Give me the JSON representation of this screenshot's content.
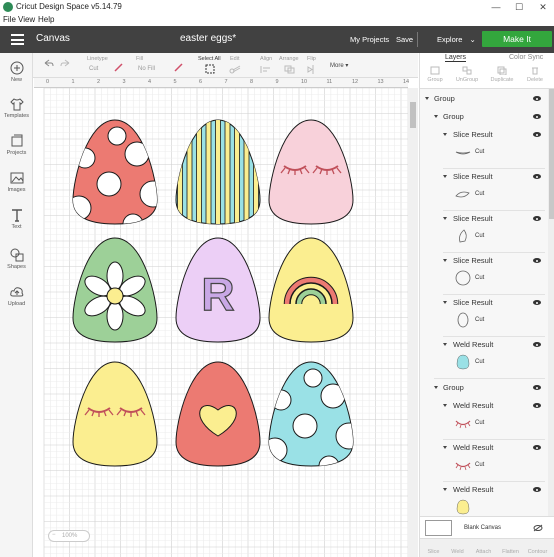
{
  "window": {
    "title": "Cricut Design Space  v5.14.79",
    "controls": [
      "—",
      "☐",
      "✕"
    ]
  },
  "menu": [
    "File",
    "View",
    "Help"
  ],
  "header": {
    "canvas_label": "Canvas",
    "doc_title": "easter eggs*",
    "my_projects": "My Projects",
    "save": "Save",
    "explore": "Explore",
    "make_it": "Make It"
  },
  "toolbar": {
    "linetype_label": "Linetype",
    "linetype_value": "Cut",
    "fill_label": "Fill",
    "fill_value": "No Fill",
    "select_all": "Select All",
    "edit": "Edit",
    "align": "Align",
    "arrange": "Arrange",
    "flip": "Flip",
    "more": "More"
  },
  "sidebar": [
    {
      "label": "New",
      "icon": "plus-icon"
    },
    {
      "label": "Templates",
      "icon": "shirt-icon"
    },
    {
      "label": "Projects",
      "icon": "projects-icon"
    },
    {
      "label": "Images",
      "icon": "image-icon"
    },
    {
      "label": "Text",
      "icon": "text-icon"
    },
    {
      "label": "Shapes",
      "icon": "shapes-icon"
    },
    {
      "label": "Upload",
      "icon": "upload-icon"
    }
  ],
  "ruler": {
    "top": [
      "0",
      "1",
      "2",
      "3",
      "4",
      "5",
      "6",
      "7",
      "8",
      "9",
      "10",
      "11",
      "12",
      "13",
      "14"
    ],
    "left": [
      "0",
      "1",
      "2",
      "3",
      "4",
      "5",
      "6",
      "7",
      "8",
      "9",
      "10",
      "11",
      "12"
    ]
  },
  "zoom": "100%",
  "eggs": [
    {
      "color": "#ec7a72",
      "design": "dots"
    },
    {
      "color": "#9ae1e6",
      "design": "stripes"
    },
    {
      "color": "#f8d1da",
      "design": "lashes"
    },
    {
      "color": "#9dd098",
      "design": "flower"
    },
    {
      "color": "#eccff6",
      "design": "letter",
      "letter": "R"
    },
    {
      "color": "#fbee90",
      "design": "rainbow"
    },
    {
      "color": "#fbee90",
      "design": "lashes"
    },
    {
      "color": "#ec7a72",
      "design": "heart"
    },
    {
      "color": "#9ae1e6",
      "design": "dots"
    }
  ],
  "panel": {
    "tab_layers": "Layers",
    "tab_color_sync": "Color Sync",
    "tools": [
      "Group",
      "UnGroup",
      "Duplicate",
      "Delete"
    ],
    "blank_canvas": "Blank Canvas",
    "bottom_tools": [
      "Slice",
      "Weld",
      "Attach",
      "Flatten",
      "Contour"
    ],
    "layers": [
      {
        "label": "Group",
        "level": 0
      },
      {
        "label": "Group",
        "level": 1
      },
      {
        "label": "Slice Result",
        "cut": "Cut",
        "thumb": "lashes-line"
      },
      {
        "label": "Slice Result",
        "cut": "Cut",
        "thumb": "lash-outline"
      },
      {
        "label": "Slice Result",
        "cut": "Cut",
        "thumb": "petal-outline"
      },
      {
        "label": "Slice Result",
        "cut": "Cut",
        "thumb": "circle-outline"
      },
      {
        "label": "Slice Result",
        "cut": "Cut",
        "thumb": "oval-outline"
      },
      {
        "label": "Weld Result",
        "cut": "Cut",
        "thumb": "blue-egg"
      },
      {
        "label": "Group",
        "level": 1
      },
      {
        "label": "Weld Result",
        "cut": "Cut",
        "thumb": "pink-lashes"
      },
      {
        "label": "Weld Result",
        "cut": "Cut",
        "thumb": "pink-lashes"
      },
      {
        "label": "Weld Result",
        "cut": "Cut",
        "thumb": "yellow-egg"
      }
    ]
  }
}
